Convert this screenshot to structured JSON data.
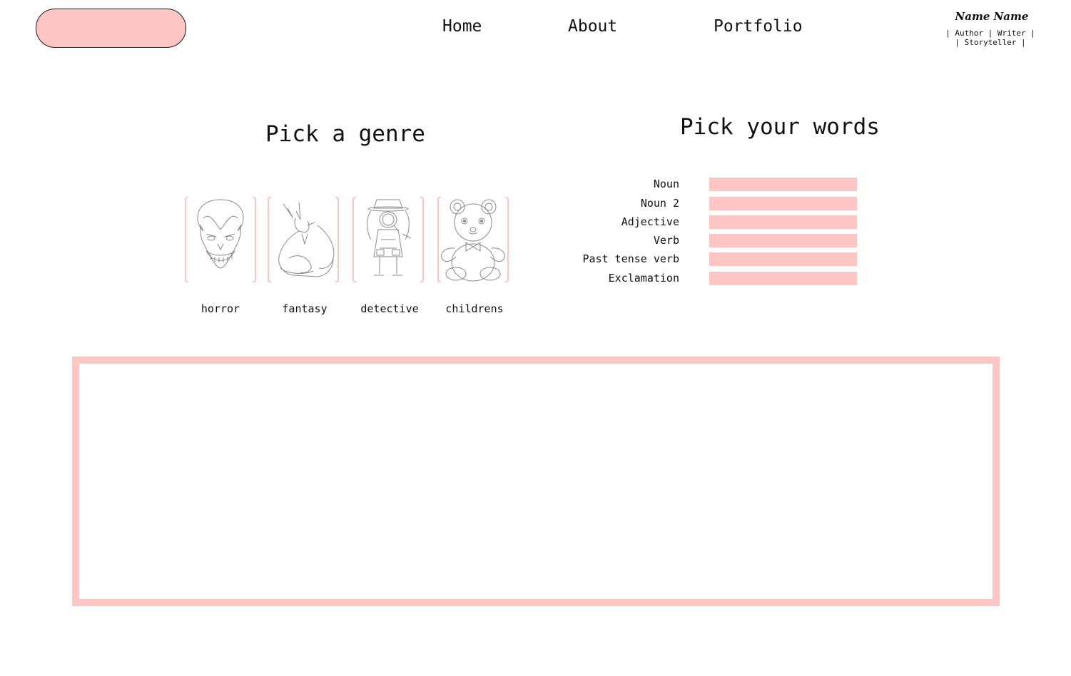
{
  "header": {
    "nav": [
      {
        "label": "Home"
      },
      {
        "label": "About"
      },
      {
        "label": "Portfolio"
      }
    ],
    "brand": {
      "name": "Name Name",
      "tagline": "| Author | Writer |\n| Storyteller |"
    }
  },
  "genre": {
    "title": "Pick a genre",
    "options": [
      {
        "label": "horror",
        "icon": "clown-face-icon"
      },
      {
        "label": "fantasy",
        "icon": "dragon-icon"
      },
      {
        "label": "detective",
        "icon": "detective-girl-icon"
      },
      {
        "label": "childrens",
        "icon": "teddy-bear-icon"
      }
    ]
  },
  "words": {
    "title": "Pick your words",
    "fields": [
      {
        "label": "Noun",
        "value": ""
      },
      {
        "label": "Noun 2",
        "value": ""
      },
      {
        "label": "Adjective",
        "value": ""
      },
      {
        "label": "Verb",
        "value": ""
      },
      {
        "label": "Past tense verb",
        "value": ""
      },
      {
        "label": "Exclamation",
        "value": ""
      }
    ]
  },
  "story": {
    "text": ""
  },
  "colors": {
    "accent": "#fdc6c2",
    "text": "#111111",
    "background": "#ffffff"
  }
}
